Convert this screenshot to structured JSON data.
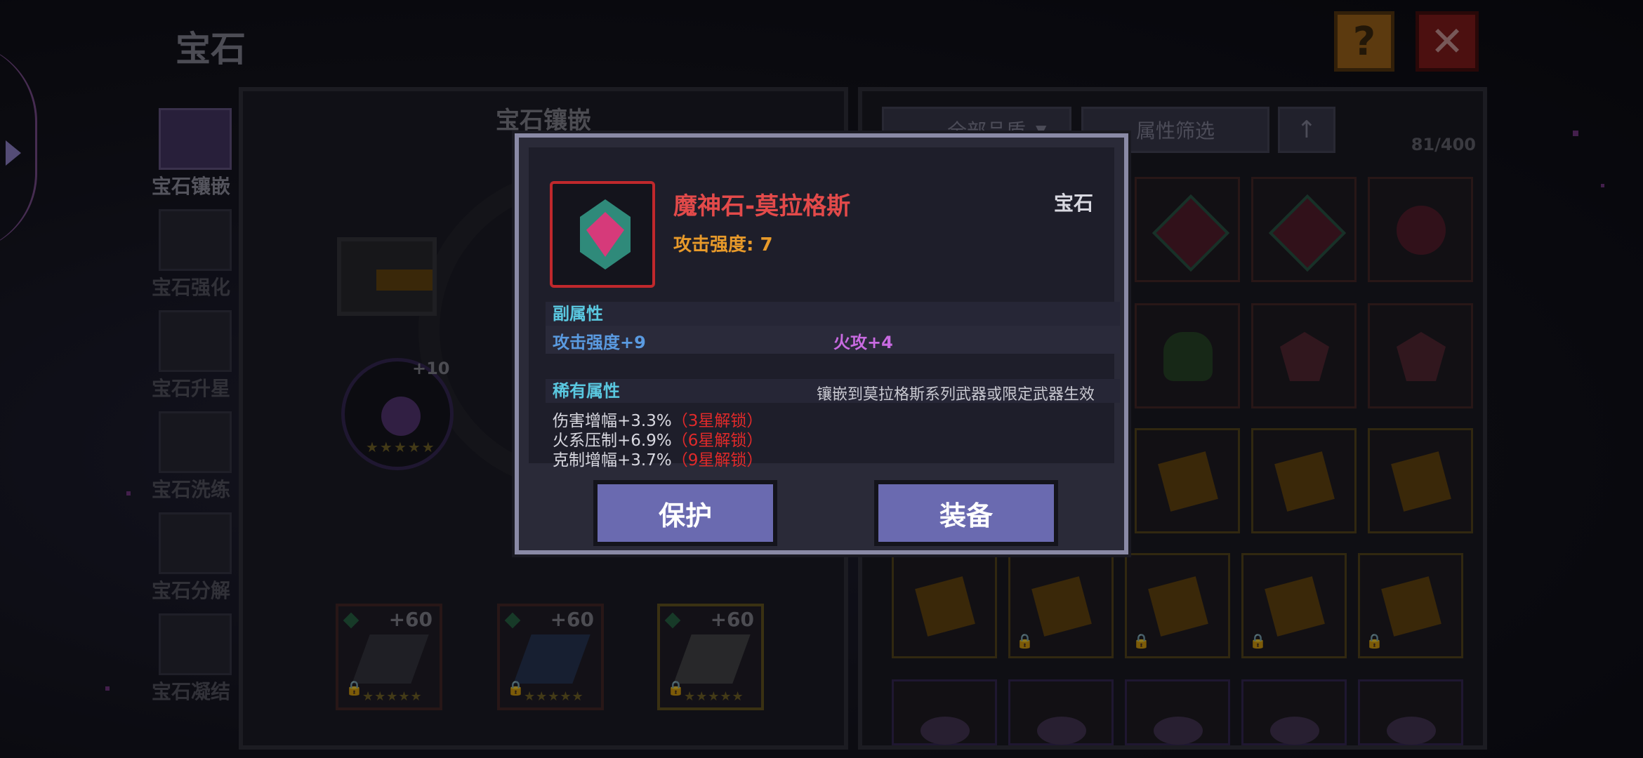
{
  "header": {
    "title": "宝石",
    "help_label": "?",
    "close_label": "✕"
  },
  "tabs": [
    {
      "label": "宝石镶嵌",
      "active": true
    },
    {
      "label": "宝石强化",
      "active": false
    },
    {
      "label": "宝石升星",
      "active": false
    },
    {
      "label": "宝石洗练",
      "active": false
    },
    {
      "label": "宝石分解",
      "active": false
    },
    {
      "label": "宝石凝结",
      "active": false
    }
  ],
  "left_panel": {
    "title": "宝石镶嵌",
    "slot": {
      "level": "+10",
      "stars": "★★★★★"
    },
    "weapons": [
      {
        "level": "+60",
        "stars": "★★★★★",
        "locked": true
      },
      {
        "level": "+60",
        "stars": "★★★★★",
        "locked": true
      },
      {
        "level": "+60",
        "stars": "★★★★★",
        "locked": true,
        "selected": true
      }
    ]
  },
  "right_panel": {
    "quality_filter": "全部品质",
    "attr_filter": "属性筛选",
    "sort_icon": "↑",
    "count": "81/400",
    "grid": [
      [
        "gem",
        "gem",
        "gem",
        "crest"
      ],
      [
        "plant",
        "crest",
        "crest"
      ],
      [
        "scroll",
        "scroll",
        "scroll"
      ],
      [
        "scroll",
        "scroll",
        "scroll",
        "scroll",
        "scroll"
      ],
      [
        "orb",
        "orb",
        "orb",
        "orb",
        "orb"
      ]
    ]
  },
  "dialog": {
    "name": "魔神石-莫拉格斯",
    "type": "宝石",
    "main_stat": "攻击强度: 7",
    "sub_header": "副属性",
    "sub_stats": [
      "攻击强度+9",
      "火攻+4"
    ],
    "rare_header": "稀有属性",
    "rare_note": "镶嵌到莫拉格斯系列武器或限定武器生效",
    "rare_stats": [
      {
        "text": "伤害增幅+3.3%",
        "unlock": "（3星解锁）"
      },
      {
        "text": "火系压制+6.9%",
        "unlock": "（6星解锁）"
      },
      {
        "text": "克制增幅+3.7%",
        "unlock": "（9星解锁）"
      }
    ],
    "protect_label": "保护",
    "equip_label": "装备"
  },
  "colors": {
    "accent_red": "#e34a4a",
    "stat_orange": "#e89a2a",
    "unlock_red": "#e02a2a",
    "button": "#6a6ab0"
  }
}
